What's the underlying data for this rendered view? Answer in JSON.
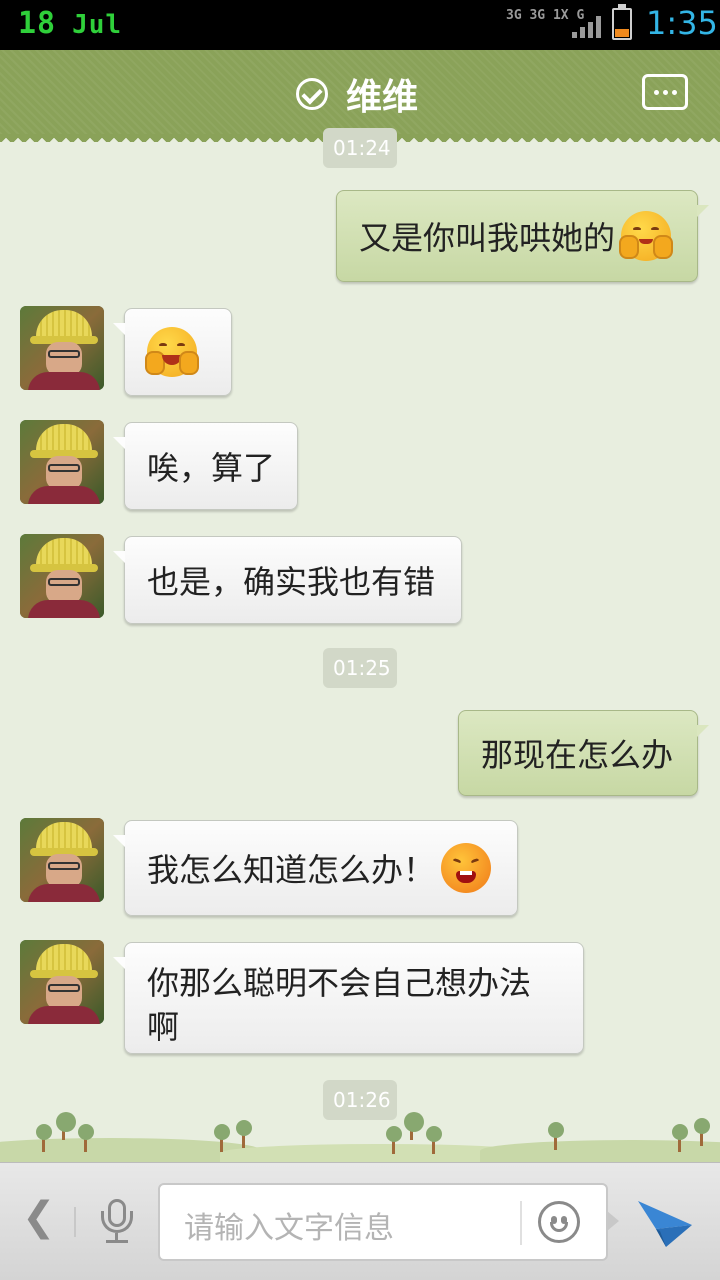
{
  "status_bar": {
    "day": "18",
    "month": "Jul",
    "net_top": "3G 3G 1X G",
    "time": "1:35"
  },
  "header": {
    "title": "维维"
  },
  "timestamps": [
    "01:24",
    "01:25",
    "01:26"
  ],
  "messages": [
    {
      "side": "out",
      "text": "又是你叫我哄她的",
      "emoji": "shy-emoji"
    },
    {
      "side": "in",
      "text": "",
      "emoji": "laughing-emoji"
    },
    {
      "side": "in",
      "text": "唉，算了"
    },
    {
      "side": "in",
      "text": "也是，确实我也有错"
    },
    {
      "side": "out",
      "text": "那现在怎么办"
    },
    {
      "side": "in",
      "text": "我怎么知道怎么办！",
      "emoji": "angry-emoji"
    },
    {
      "side": "in",
      "text": "你那么聪明不会自己想办法啊"
    }
  ],
  "input": {
    "placeholder": "请输入文字信息"
  },
  "colors": {
    "title_bar": "#8aa259",
    "outgoing_bubble": "#c7d8a4",
    "incoming_bubble": "#f4f4f4",
    "background": "#e8eedf"
  }
}
